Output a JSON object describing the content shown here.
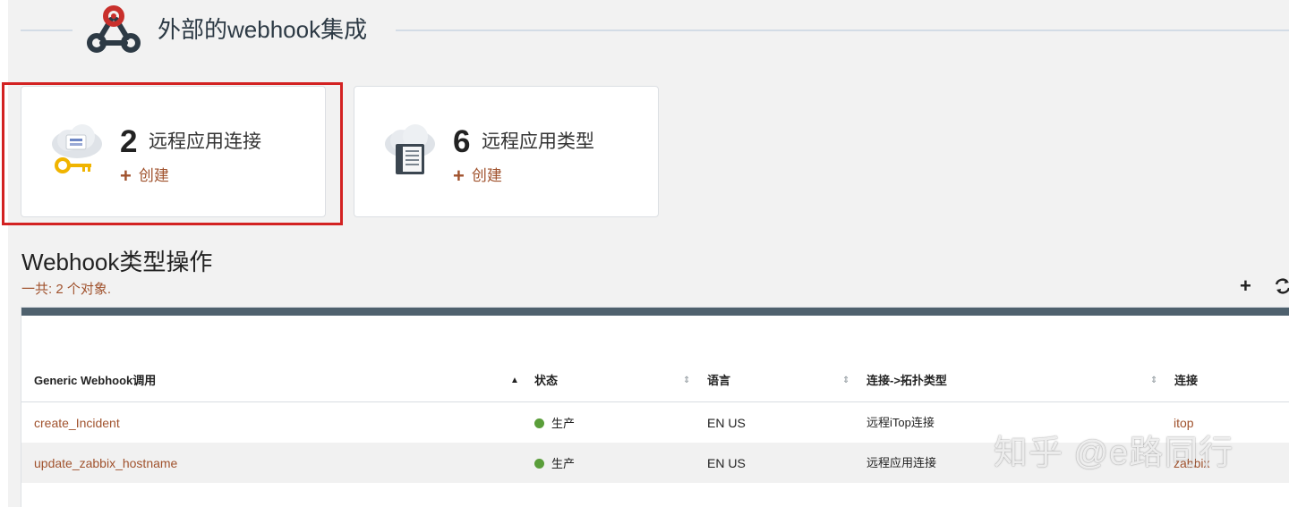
{
  "header": {
    "title": "外部的webhook集成"
  },
  "cards": [
    {
      "count": "2",
      "label": "远程应用连接",
      "create_label": "创建"
    },
    {
      "count": "6",
      "label": "远程应用类型",
      "create_label": "创建"
    }
  ],
  "section": {
    "title": "Webhook类型操作",
    "count_text": "一共: 2 个对象."
  },
  "table": {
    "columns": [
      "Generic Webhook调用",
      "状态",
      "语言",
      "连接->拓扑类型",
      "连接"
    ],
    "rows": [
      {
        "name": "create_Incident",
        "status": "生产",
        "language": "EN US",
        "type": "远程iTop连接",
        "connection": "itop"
      },
      {
        "name": "update_zabbix_hostname",
        "status": "生产",
        "language": "EN US",
        "type": "远程应用连接",
        "connection": "zabbix"
      }
    ]
  },
  "watermark": "知乎 @e路同行",
  "colors": {
    "accent": "#a0522d",
    "status_ok": "#5a9e3a",
    "highlight": "#d32222",
    "table_bar": "#4f616e"
  },
  "icons": [
    "webhook-logo-icon",
    "cloud-key-icon",
    "cloud-server-icon",
    "plus-icon",
    "refresh-icon",
    "sort-icon"
  ]
}
